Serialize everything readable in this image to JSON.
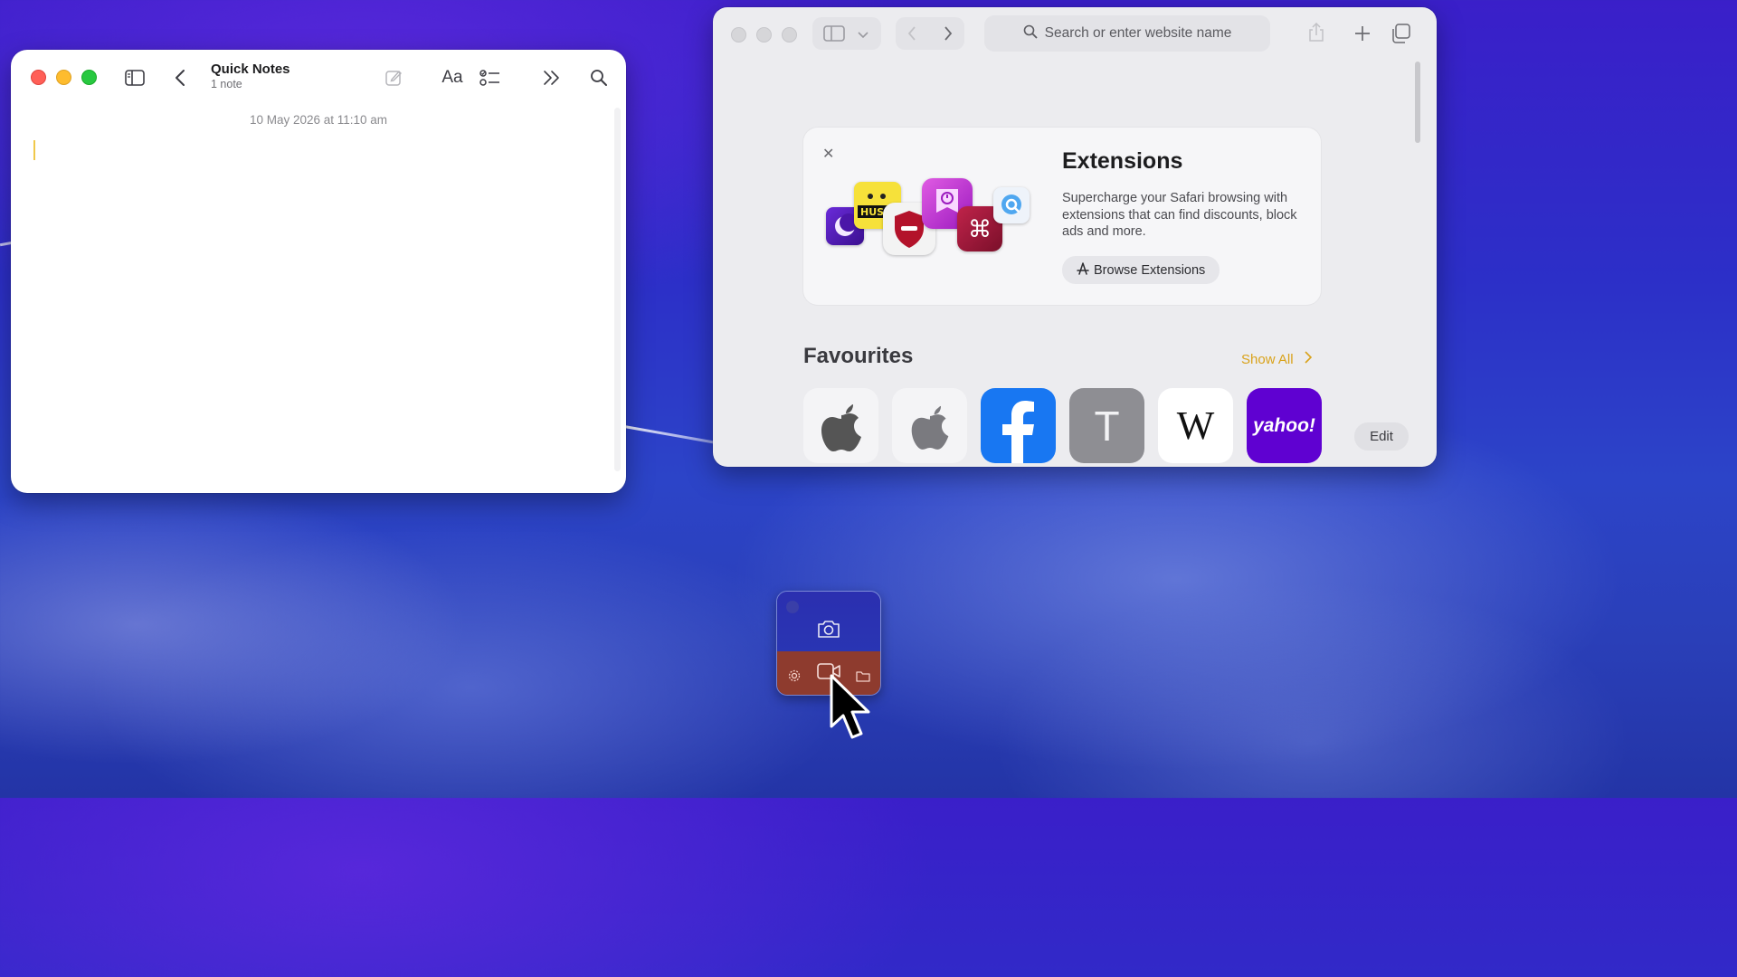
{
  "notes": {
    "title": "Quick Notes",
    "subtitle": "1 note",
    "date": "10 May 2026 at 11:10 am",
    "format_label": "Aa"
  },
  "safari": {
    "search_placeholder": "Search or enter website name",
    "extensions": {
      "title": "Extensions",
      "description": "Supercharge your Safari browsing with extensions that can find discounts, block ads and more.",
      "button_label": "Browse Extensions"
    },
    "favourites": {
      "title": "Favourites",
      "show_all_label": "Show All",
      "items": [
        {
          "name": "apple-1",
          "icon": "apple-logo"
        },
        {
          "name": "apple-2",
          "icon": "apple-logo"
        },
        {
          "name": "facebook",
          "icon": "facebook-logo"
        },
        {
          "name": "t-tile",
          "letter": "T"
        },
        {
          "name": "wikipedia",
          "letter": "W"
        },
        {
          "name": "yahoo",
          "text": "yahoo!"
        }
      ],
      "edit_label": "Edit"
    }
  },
  "widget": {
    "icons": [
      "camera-icon",
      "settings-icon",
      "video-record-icon",
      "folder-icon"
    ]
  },
  "colors": {
    "accent_gold": "#d9a21a",
    "facebook_blue": "#1877f2",
    "yahoo_purple": "#5f01d1"
  }
}
